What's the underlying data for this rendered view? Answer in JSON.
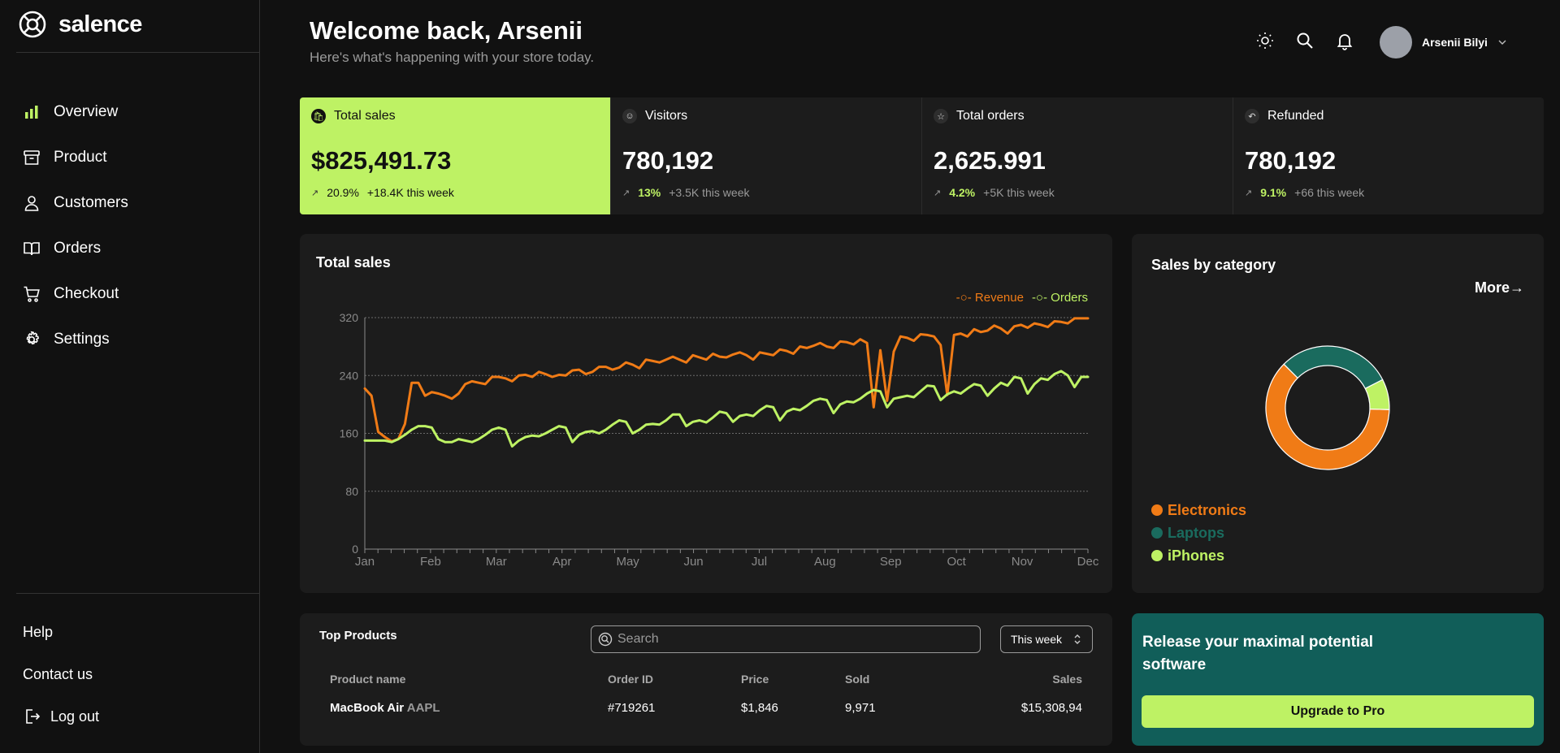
{
  "brand": {
    "name": "salence"
  },
  "nav": [
    {
      "label": "Overview",
      "icon": "bar-chart-icon"
    },
    {
      "label": "Product",
      "icon": "archive-icon"
    },
    {
      "label": "Customers",
      "icon": "user-icon"
    },
    {
      "label": "Orders",
      "icon": "book-icon"
    },
    {
      "label": "Checkout",
      "icon": "cart-icon"
    },
    {
      "label": "Settings",
      "icon": "gear-icon"
    }
  ],
  "bottom_nav": {
    "help": "Help",
    "contact": "Contact us",
    "logout": "Log out"
  },
  "header": {
    "title": "Welcome back, Arsenii",
    "subtitle": "Here's what's happening with your store today.",
    "user_name": "Arsenii Bilyi"
  },
  "stats": [
    {
      "label": "Total sales",
      "value": "$825,491.73",
      "pct": "20.9%",
      "week": "+18.4K this week",
      "icon": "bag-icon"
    },
    {
      "label": "Visitors",
      "value": "780,192",
      "pct": "13%",
      "week": "+3.5K this week",
      "icon": "users-icon"
    },
    {
      "label": "Total orders",
      "value": "2,625.991",
      "pct": "4.2%",
      "week": "+5K this week",
      "icon": "star-icon"
    },
    {
      "label": "Refunded",
      "value": "780,192",
      "pct": "9.1%",
      "week": "+66 this week",
      "icon": "undo-icon"
    }
  ],
  "sales_card": {
    "title": "Total sales"
  },
  "category_card": {
    "title": "Sales by category",
    "more": "More→"
  },
  "colors": {
    "accent": "#bef264",
    "revenue": "#f07b16",
    "laptops": "#1a6b5e",
    "promo_bg": "#115e59"
  },
  "chart_data": [
    {
      "type": "line",
      "title": "Total sales",
      "x_ticks": [
        "Jan",
        "Feb",
        "Mar",
        "Apr",
        "May",
        "Jun",
        "Jul",
        "Aug",
        "Sep",
        "Oct",
        "Nov",
        "Dec"
      ],
      "ylim": [
        0,
        320
      ],
      "y_ticks": [
        0,
        80,
        160,
        240,
        320
      ],
      "grid": true,
      "legend": "top-right",
      "series": [
        {
          "name": "Revenue",
          "color": "#f07b16",
          "values": [
            222,
            212,
            162,
            155,
            149,
            152,
            173,
            230,
            230,
            212,
            217,
            215,
            212,
            208,
            215,
            228,
            232,
            230,
            228,
            238,
            238,
            236,
            232,
            240,
            241,
            238,
            245,
            242,
            238,
            241,
            240,
            247,
            248,
            242,
            245,
            252,
            252,
            248,
            251,
            258,
            255,
            250,
            262,
            260,
            258,
            262,
            266,
            262,
            258,
            268,
            265,
            262,
            270,
            266,
            265,
            269,
            272,
            268,
            262,
            272,
            270,
            268,
            276,
            274,
            270,
            280,
            278,
            281,
            285,
            280,
            278,
            287,
            286,
            283,
            290,
            285,
            196,
            275,
            205,
            273,
            294,
            292,
            288,
            297,
            296,
            294,
            282,
            213,
            296,
            298,
            294,
            304,
            300,
            302,
            309,
            305,
            298,
            308,
            310,
            306,
            312,
            310,
            307,
            315,
            314,
            312,
            319,
            319,
            319
          ]
        },
        {
          "name": "Orders",
          "color": "#bef264",
          "values": [
            150,
            150,
            150,
            150,
            148,
            152,
            158,
            165,
            170,
            170,
            168,
            152,
            148,
            148,
            152,
            150,
            148,
            152,
            158,
            165,
            168,
            165,
            142,
            150,
            155,
            157,
            156,
            160,
            165,
            170,
            168,
            148,
            158,
            162,
            163,
            160,
            165,
            172,
            178,
            176,
            160,
            165,
            172,
            173,
            172,
            178,
            186,
            186,
            170,
            176,
            178,
            175,
            182,
            190,
            188,
            176,
            184,
            186,
            184,
            192,
            198,
            196,
            178,
            190,
            194,
            192,
            198,
            205,
            208,
            206,
            188,
            200,
            204,
            203,
            208,
            215,
            220,
            218,
            196,
            208,
            210,
            212,
            210,
            218,
            226,
            225,
            206,
            214,
            218,
            215,
            222,
            228,
            226,
            212,
            222,
            230,
            226,
            238,
            236,
            215,
            228,
            236,
            234,
            242,
            246,
            240,
            224,
            238,
            238
          ]
        }
      ]
    },
    {
      "type": "pie",
      "title": "Sales by category",
      "labels": [
        "Electronics",
        "Laptops",
        "iPhones"
      ],
      "values": [
        62,
        30,
        8
      ],
      "colors": [
        "#f07b16",
        "#1a6b5e",
        "#bef264"
      ],
      "legend": "bottom-left"
    }
  ],
  "products": {
    "title": "Top Products",
    "search_placeholder": "Search",
    "period": "This week",
    "columns": [
      "Product name",
      "Order ID",
      "Price",
      "Sold",
      "Sales"
    ],
    "rows": [
      {
        "name": "MacBook Air",
        "ticker": "AAPL",
        "order_id": "#719261",
        "price": "$1,846",
        "sold": "9,971",
        "sales": "$15,308,94"
      }
    ]
  },
  "promo": {
    "title": "Release your maximal potential software",
    "button": "Upgrade to Pro"
  }
}
